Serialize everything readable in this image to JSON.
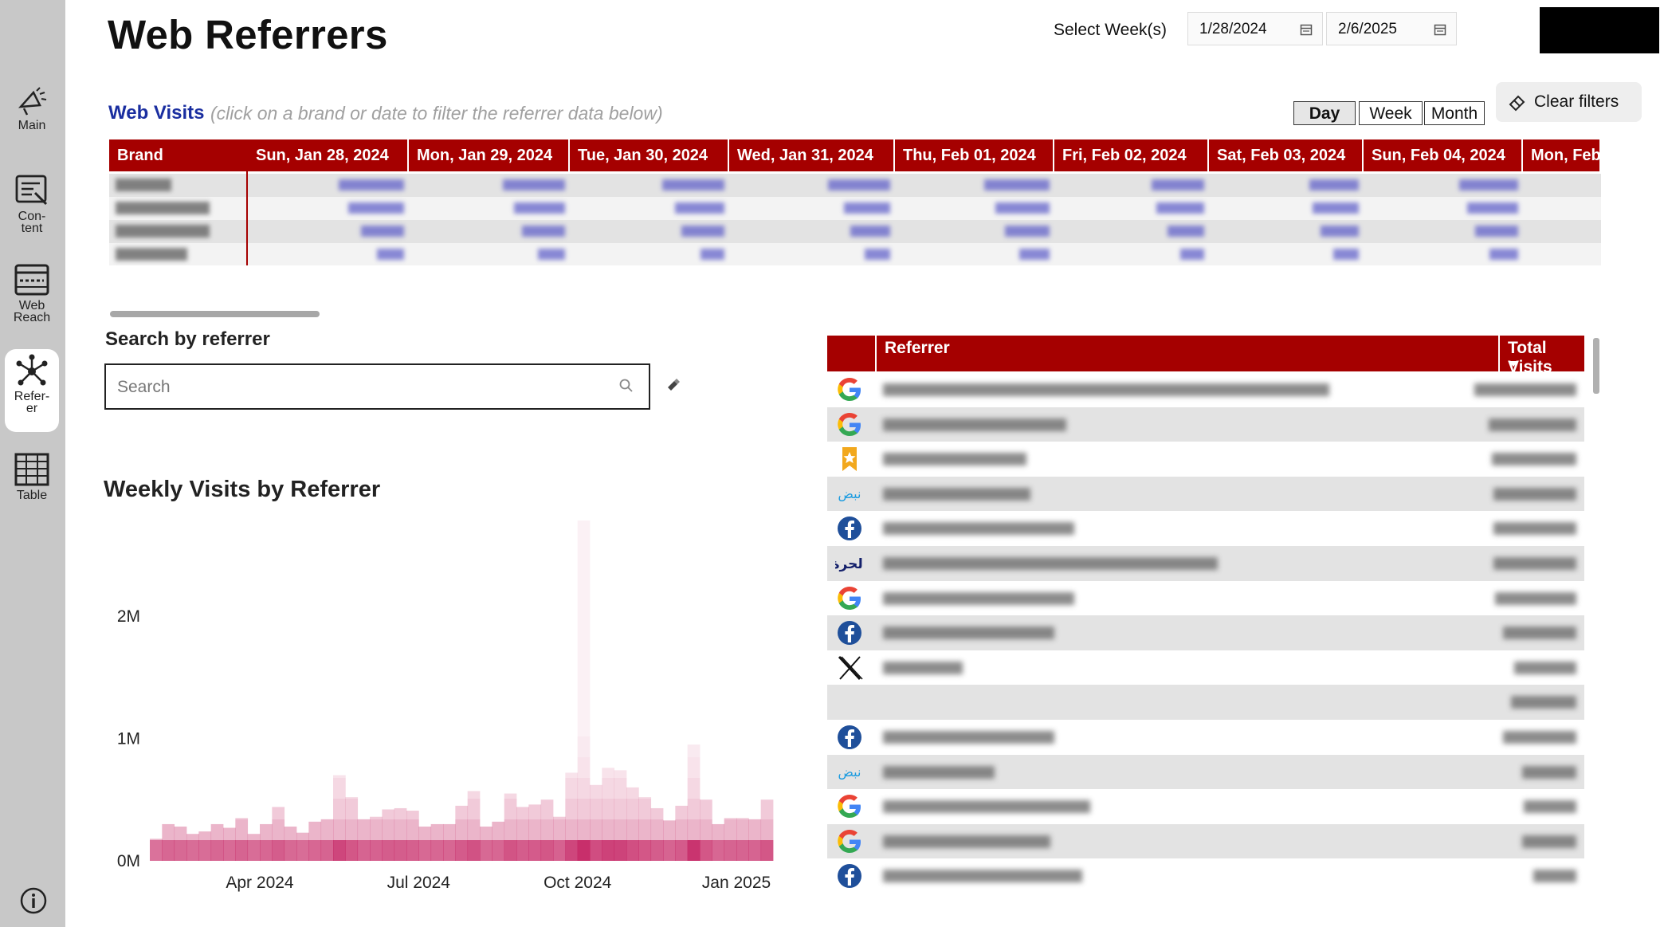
{
  "sidebar": {
    "items": [
      {
        "label_lines": [
          "Main"
        ],
        "icon": "megaphone-icon",
        "active": false
      },
      {
        "label_lines": [
          "Con-",
          "tent"
        ],
        "icon": "content-icon",
        "active": false
      },
      {
        "label_lines": [
          "Web",
          "Reach"
        ],
        "icon": "browser-icon",
        "active": false
      },
      {
        "label_lines": [
          "Refer-",
          "er"
        ],
        "icon": "network-icon",
        "active": true
      },
      {
        "label_lines": [
          "Table"
        ],
        "icon": "table-icon",
        "active": false
      }
    ],
    "info_icon": "info-icon"
  },
  "header": {
    "title": "Web Referrers",
    "week_label": "Select Week(s)",
    "start_date": "1/28/2024",
    "end_date": "2/6/2025"
  },
  "visits": {
    "title": "Web Visits",
    "hint": "(click on a brand or date to filter the referrer data below)",
    "granularity": [
      "Day",
      "Week",
      "Month"
    ],
    "selected_granularity": "Day",
    "clear_filters_label": "Clear filters",
    "table": {
      "columns": [
        "Brand",
        "Sun, Jan 28, 2024",
        "Mon, Jan 29, 2024",
        "Tue, Jan 30, 2024",
        "Wed, Jan 31, 2024",
        "Thu, Feb 01, 2024",
        "Fri, Feb 02, 2024",
        "Sat, Feb 03, 2024",
        "Sun, Feb 04, 2024",
        "Mon, Feb"
      ],
      "row_count": 4,
      "cells_obscured": true
    }
  },
  "search": {
    "label": "Search by referrer",
    "placeholder": "Search",
    "value": ""
  },
  "chart_data": {
    "type": "heatmap",
    "title": "Weekly Visits by Referrer",
    "xlabel": "",
    "ylabel": "",
    "x_tick_labels": [
      "Apr 2024",
      "Jul 2024",
      "Oct 2024",
      "Jan 2025"
    ],
    "y_tick_labels": [
      "0M",
      "1M",
      "2M"
    ],
    "ylim": [
      0,
      2800000
    ],
    "week_totals_m": [
      0.18,
      0.3,
      0.28,
      0.22,
      0.24,
      0.3,
      0.27,
      0.35,
      0.22,
      0.3,
      0.44,
      0.28,
      0.23,
      0.32,
      0.34,
      0.7,
      0.52,
      0.34,
      0.36,
      0.42,
      0.43,
      0.41,
      0.28,
      0.3,
      0.3,
      0.45,
      0.57,
      0.28,
      0.32,
      0.55,
      0.44,
      0.46,
      0.5,
      0.36,
      0.72,
      2.78,
      0.62,
      0.76,
      0.74,
      0.6,
      0.52,
      0.43,
      0.33,
      0.45,
      0.95,
      0.5,
      0.3,
      0.35,
      0.35,
      0.34,
      0.5
    ]
  },
  "referrers": {
    "columns": [
      "Referrer",
      "Total Visits"
    ],
    "sort_indicator": "sort-desc-icon",
    "rows": [
      {
        "icon": "google-icon"
      },
      {
        "icon": "google-icon"
      },
      {
        "icon": "bookmark-star-icon"
      },
      {
        "icon": "nabd-icon"
      },
      {
        "icon": "facebook-icon"
      },
      {
        "icon": "alhurra-icon"
      },
      {
        "icon": "google-icon"
      },
      {
        "icon": "facebook-icon"
      },
      {
        "icon": "x-icon"
      },
      {
        "icon": "none"
      },
      {
        "icon": "facebook-icon"
      },
      {
        "icon": "nabd-icon"
      },
      {
        "icon": "google-icon"
      },
      {
        "icon": "google-icon"
      },
      {
        "icon": "facebook-icon"
      }
    ],
    "values_obscured": true
  },
  "colors": {
    "sidebar": "#c8c8c8",
    "header_red": "#a50000",
    "title_blue": "#1a2ea0",
    "heat": "#c2185b"
  }
}
